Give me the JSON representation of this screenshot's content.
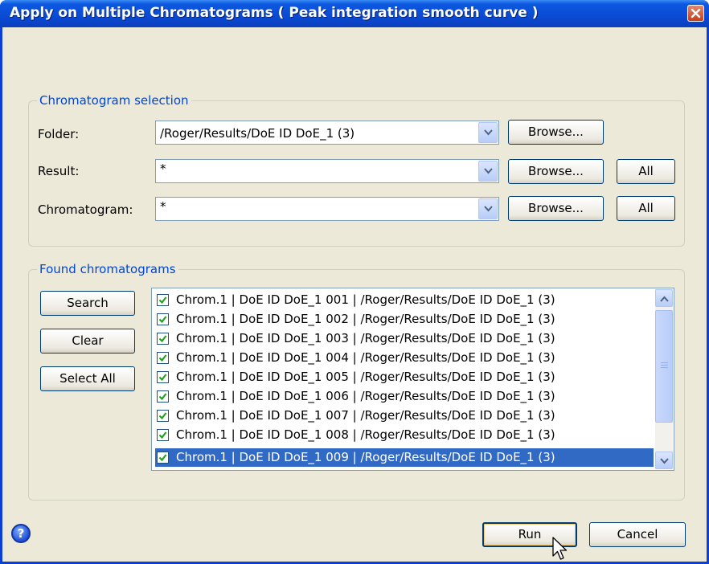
{
  "window": {
    "title": "Apply on Multiple Chromatograms ( Peak integration smooth curve )"
  },
  "selection": {
    "group_label": "Chromatogram selection",
    "folder": {
      "label": "Folder:",
      "value": "/Roger/Results/DoE ID DoE_1 (3)"
    },
    "result": {
      "label": "Result:",
      "value": "*"
    },
    "chromatogram": {
      "label": "Chromatogram:",
      "value": "*"
    },
    "browse_label": "Browse...",
    "all_label": "All"
  },
  "found": {
    "group_label": "Found chromatograms",
    "search_label": "Search",
    "clear_label": "Clear",
    "select_all_label": "Select All",
    "items": [
      {
        "text": "Chrom.1 | DoE ID DoE_1 001 | /Roger/Results/DoE ID DoE_1 (3)",
        "checked": true
      },
      {
        "text": "Chrom.1 | DoE ID DoE_1 002 | /Roger/Results/DoE ID DoE_1 (3)",
        "checked": true
      },
      {
        "text": "Chrom.1 | DoE ID DoE_1 003 | /Roger/Results/DoE ID DoE_1 (3)",
        "checked": true
      },
      {
        "text": "Chrom.1 | DoE ID DoE_1 004 | /Roger/Results/DoE ID DoE_1 (3)",
        "checked": true
      },
      {
        "text": "Chrom.1 | DoE ID DoE_1 005 | /Roger/Results/DoE ID DoE_1 (3)",
        "checked": true
      },
      {
        "text": "Chrom.1 | DoE ID DoE_1 006 | /Roger/Results/DoE ID DoE_1 (3)",
        "checked": true
      },
      {
        "text": "Chrom.1 | DoE ID DoE_1 007 | /Roger/Results/DoE ID DoE_1 (3)",
        "checked": true
      },
      {
        "text": "Chrom.1 | DoE ID DoE_1 008 | /Roger/Results/DoE ID DoE_1 (3)",
        "checked": true
      },
      {
        "text": "Chrom.1 | DoE ID DoE_1 009 | /Roger/Results/DoE ID DoE_1 (3)",
        "checked": true,
        "selected": true
      }
    ]
  },
  "footer": {
    "help_icon": "help-icon",
    "help_glyph": "?",
    "run_label": "Run",
    "cancel_label": "Cancel"
  },
  "colors": {
    "title_bar": "#0a4ad4",
    "group_label": "#0046d5",
    "selection": "#316ac5"
  }
}
